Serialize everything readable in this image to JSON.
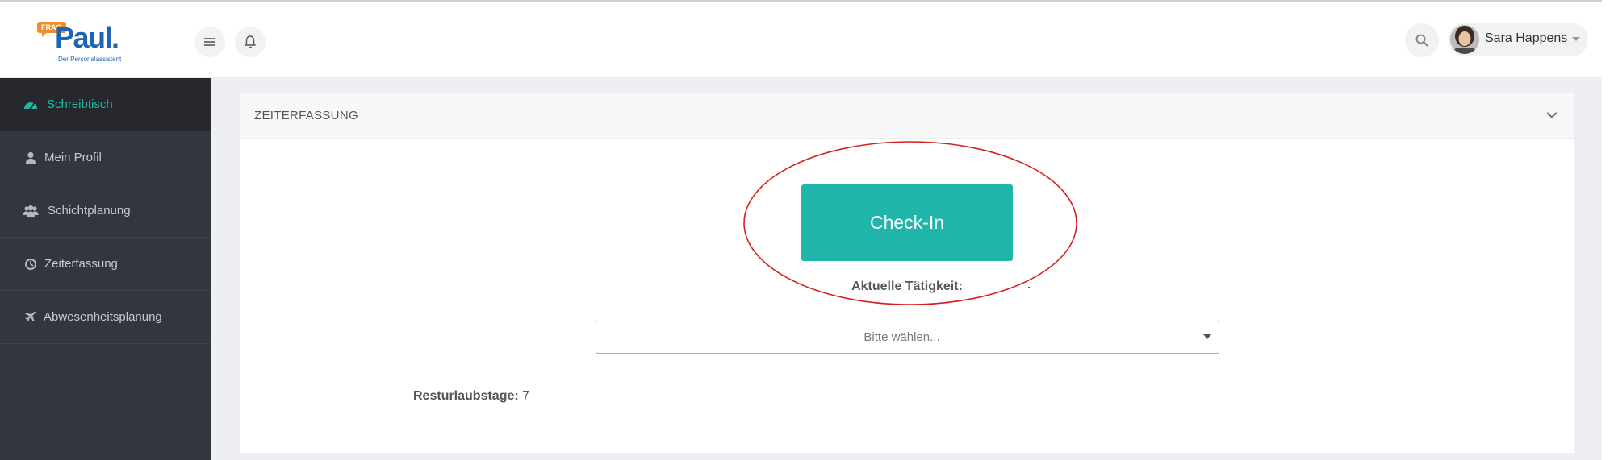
{
  "header": {
    "logo": {
      "badge": "FRAG",
      "name": "Paul.",
      "tagline": "Der Personalassistent"
    },
    "user": {
      "name": "Sara Happens"
    },
    "icons": {
      "menu": "menu-icon",
      "notifications": "bell-icon",
      "search": "search-icon",
      "user_dropdown": "caret-down-icon"
    }
  },
  "sidebar": {
    "items": [
      {
        "label": "Schreibtisch",
        "icon": "dashboard-icon",
        "active": true
      },
      {
        "label": "Mein Profil",
        "icon": "user-icon",
        "active": false
      },
      {
        "label": "Schichtplanung",
        "icon": "users-icon",
        "active": false
      },
      {
        "label": "Zeiterfassung",
        "icon": "clock-icon",
        "active": false
      },
      {
        "label": "Abwesenheitsplanung",
        "icon": "plane-icon",
        "active": false
      }
    ]
  },
  "panel": {
    "title": "ZEITERFASSUNG",
    "checkin_label": "Check-In",
    "activity_label": "Aktuelle Tätigkeit:",
    "activity_placeholder": "Bitte wählen...",
    "remaining_vacation_label": "Resturlaubstage:",
    "remaining_vacation_value": "7"
  },
  "colors": {
    "accent": "#20b5aa",
    "sidebar_bg": "#34363d",
    "sidebar_active_bg": "#26282d",
    "active_text": "#22b8a6",
    "annotation": "#d62020",
    "brand_blue": "#1e63b8",
    "brand_orange": "#f28c28"
  }
}
